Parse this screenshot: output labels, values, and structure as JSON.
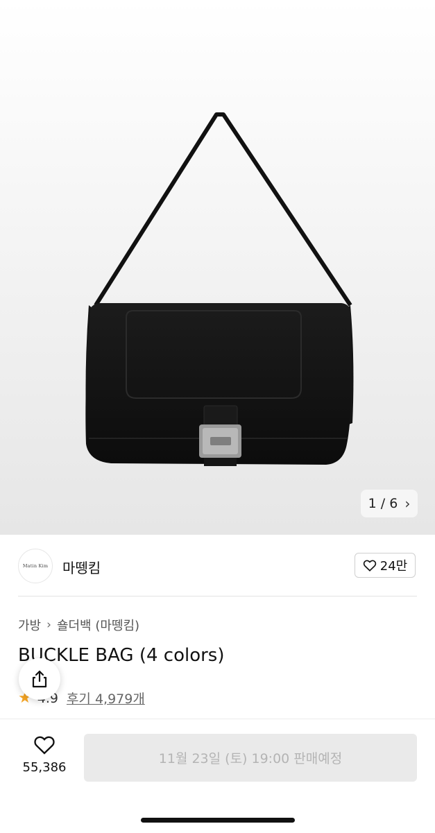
{
  "product_image": {
    "counter": "1 / 6"
  },
  "brand": {
    "logo_text": "Matin  Kim",
    "name": "마뗑킴",
    "like_count": "24만"
  },
  "breadcrumb": [
    "가방",
    "숄더백 (마뗑킴)"
  ],
  "product": {
    "title": "BUCKLE BAG (4 colors)",
    "rating": "4.9",
    "reviews": "후기 4,979개"
  },
  "bottom_bar": {
    "wish_count": "55,386",
    "sale_status": "11월 23일 (토) 19:00 판매예정"
  },
  "icons": {
    "share": "share-icon",
    "heart": "heart-icon",
    "star": "star-icon",
    "chevron": "chevron-right-icon"
  },
  "colors": {
    "accent_star": "#f5a524",
    "disabled_button": "#eaeaea",
    "disabled_text": "#b4b4b4"
  }
}
